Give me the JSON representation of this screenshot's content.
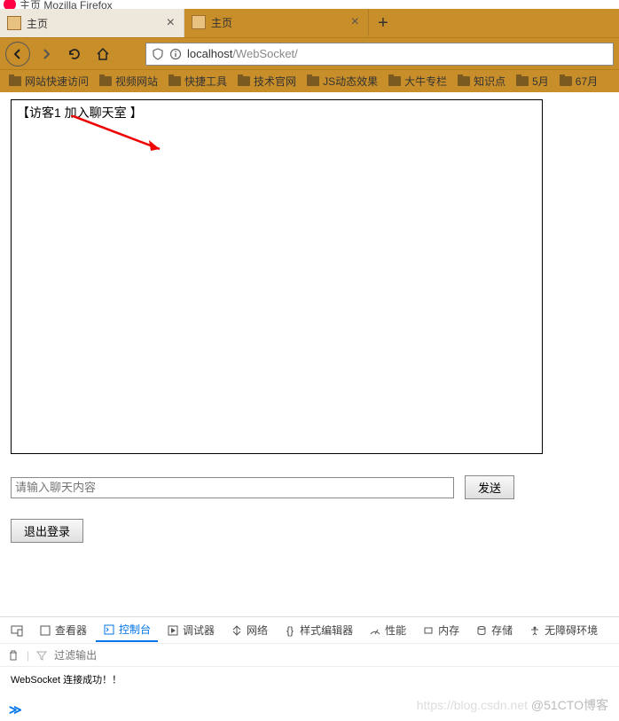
{
  "window": {
    "title": "主页  Mozilla Firefox"
  },
  "tabs": {
    "items": [
      {
        "label": "主页",
        "active": false
      },
      {
        "label": "主页",
        "active": true
      }
    ]
  },
  "url": {
    "host": "localhost",
    "path": "/WebSocket/"
  },
  "bookmarks": {
    "items": [
      {
        "label": "网站快速访问"
      },
      {
        "label": "视频网站"
      },
      {
        "label": "快捷工具"
      },
      {
        "label": "技术官网"
      },
      {
        "label": "JS动态效果"
      },
      {
        "label": "大牛专栏"
      },
      {
        "label": "知识点"
      },
      {
        "label": "5月"
      },
      {
        "label": "67月"
      }
    ]
  },
  "chat": {
    "message": "【访客1 加入聊天室 】",
    "placeholder": "请输入聊天内容",
    "send_label": "发送",
    "logout_label": "退出登录"
  },
  "devtools": {
    "tabs": {
      "inspector": "查看器",
      "console": "控制台",
      "debugger": "调试器",
      "network": "网络",
      "style": "样式编辑器",
      "performance": "性能",
      "memory": "内存",
      "storage": "存储",
      "accessibility": "无障碍环境"
    },
    "filter_placeholder": "过滤输出",
    "log": "WebSocket 连接成功！！"
  },
  "watermark": {
    "left": "https://blog.csdn.net",
    "right": "@51CTO博客"
  }
}
